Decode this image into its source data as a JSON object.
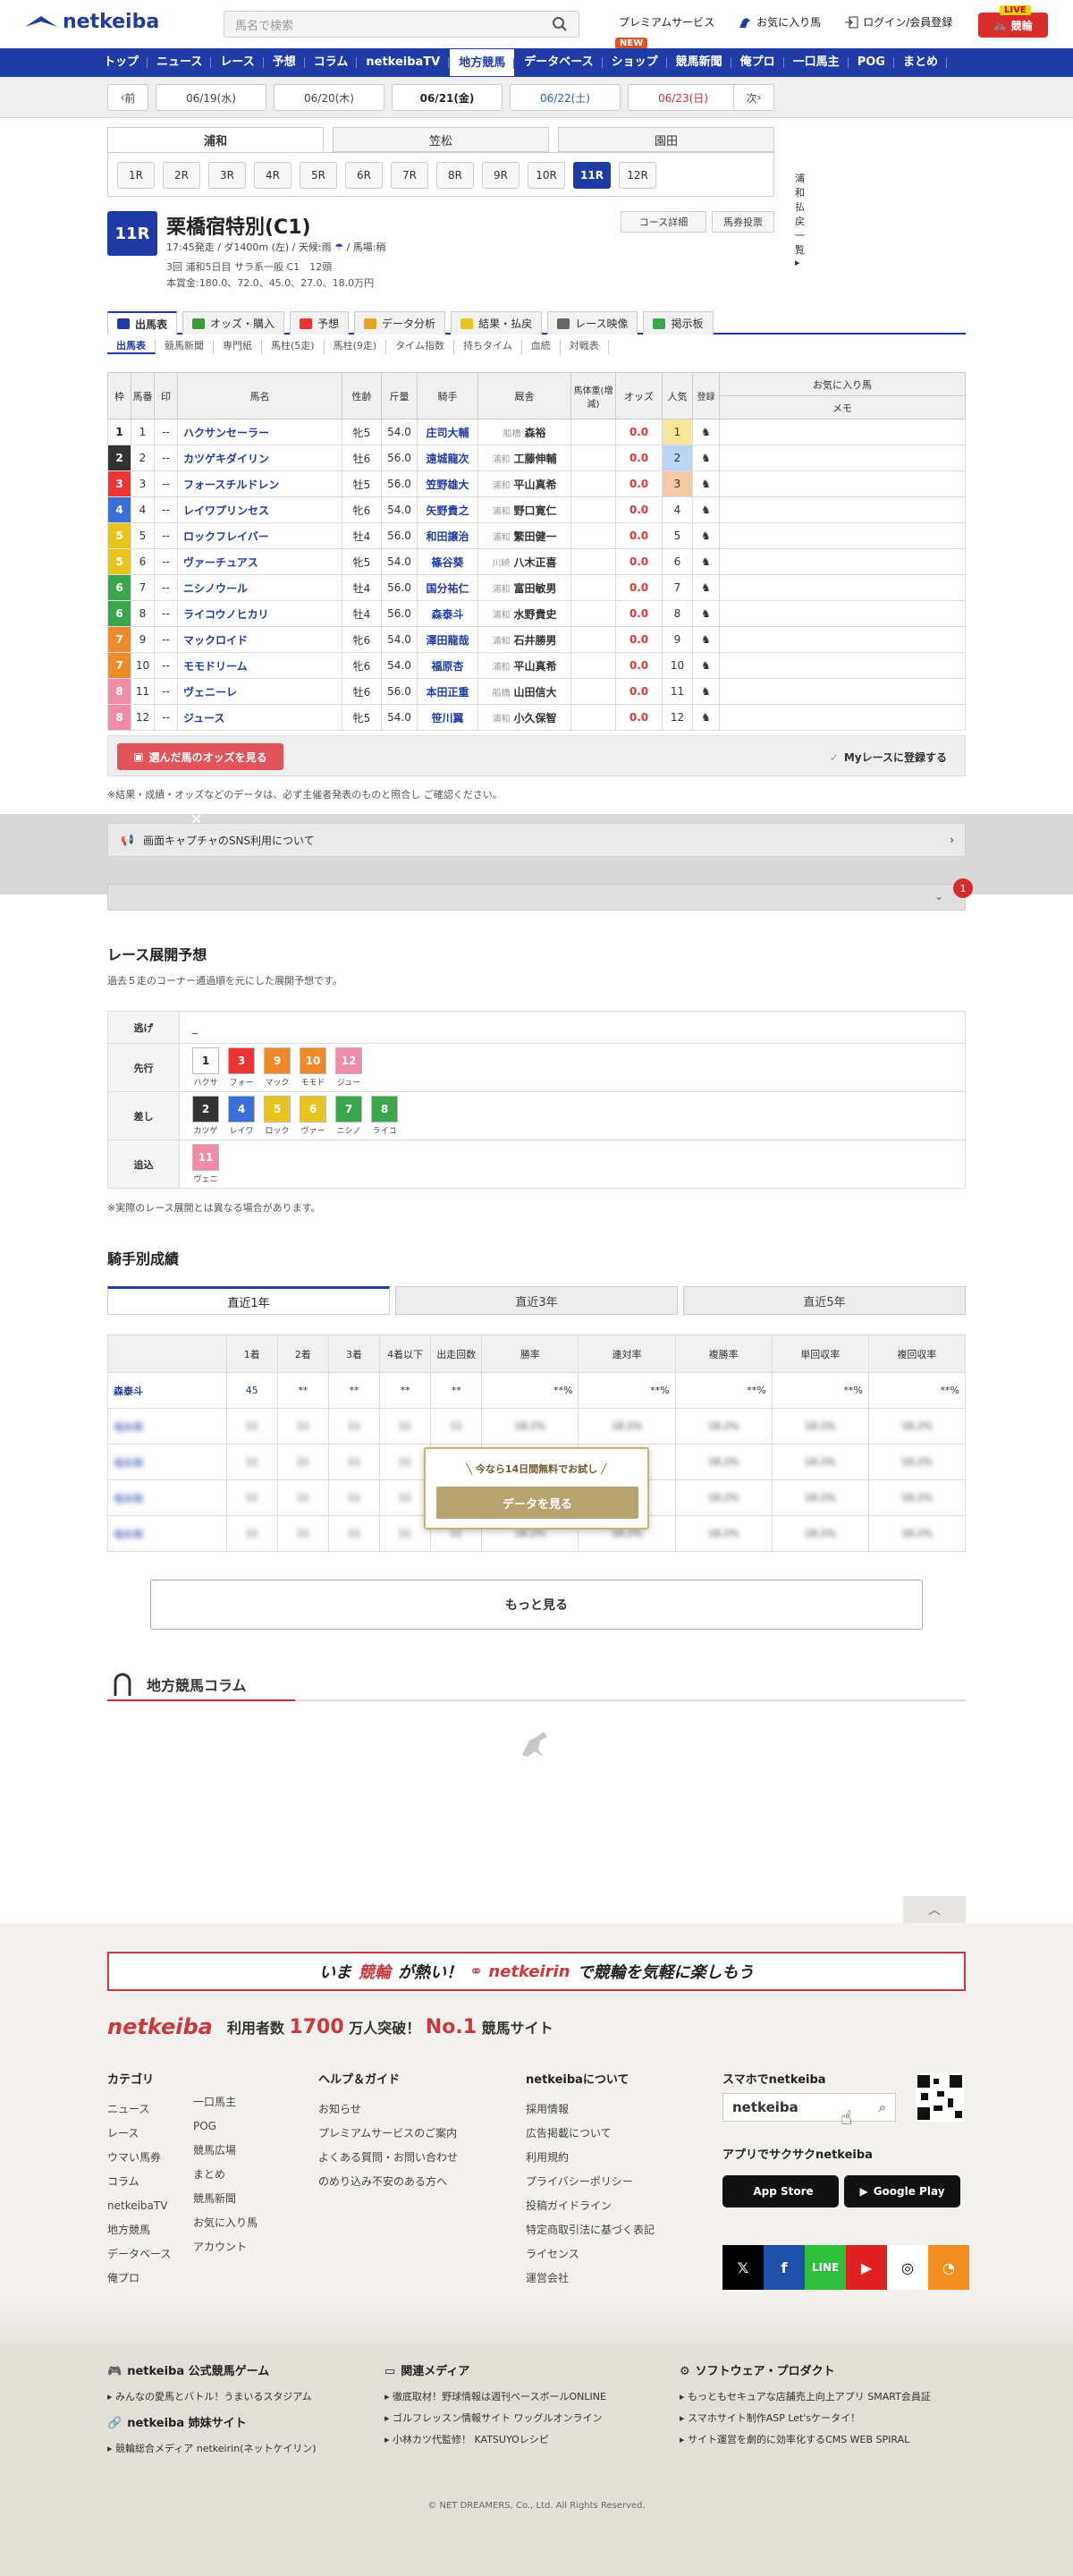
{
  "header": {
    "logo": "netkeiba",
    "search_placeholder": "馬名で検索",
    "links": [
      "プレミアムサービス",
      "お気に入り馬",
      "ログイン/会員登録"
    ],
    "new_badge": "NEW",
    "keirin_label": "競輪",
    "live_badge": "LIVE"
  },
  "nav": [
    "トップ",
    "ニュース",
    "レース",
    "予想",
    "コラム",
    "netkeibaTV",
    "地方競馬",
    "データベース",
    "ショップ",
    "競馬新聞",
    "俺プロ",
    "一口馬主",
    "POG",
    "まとめ"
  ],
  "nav_active": "地方競馬",
  "datebar": {
    "prev": "前",
    "next": "次",
    "dates": [
      "06/19(水)",
      "06/20(木)",
      "06/21(金)",
      "06/22(土)",
      "06/23(日)"
    ]
  },
  "venues": [
    "浦和",
    "笠松",
    "園田"
  ],
  "races": [
    "1R",
    "2R",
    "3R",
    "4R",
    "5R",
    "6R",
    "7R",
    "8R",
    "9R",
    "10R",
    "11R",
    "12R"
  ],
  "payout_link": "浦和 払戻一覧",
  "race": {
    "num": "11R",
    "name": "栗橋宿特別(C1)",
    "info1": "17:45発走 / ダ1400m (左) / 天候:雨",
    "info1b": "/ 馬場:稍",
    "info2": "3回 浦和5日目 サラ系一般 C1　12頭",
    "info3": "本賞金:180.0、72.0、45.0、27.0、18.0万円",
    "btn_course": "コース詳細",
    "btn_vote": "馬券投票"
  },
  "tabs": [
    "出馬表",
    "オッズ・購入",
    "予想",
    "データ分析",
    "結果・払戻",
    "レース映像",
    "掲示板"
  ],
  "subtabs": [
    "出馬表",
    "競馬新聞",
    "専門紙",
    "馬柱(5走)",
    "馬柱(9走)",
    "タイム指数",
    "持ちタイム",
    "血統",
    "対戦表"
  ],
  "table": {
    "headers": [
      "枠",
      "馬番",
      "印",
      "馬名",
      "性齢",
      "斤量",
      "騎手",
      "厩舎",
      "馬体重(増減)",
      "オッズ",
      "人気",
      "登録",
      "お気に入り馬",
      "メモ"
    ],
    "rows": [
      {
        "waku": "1",
        "num": "1",
        "mark": "--",
        "name": "ハクサンセーラー",
        "sex": "牝5",
        "kin": "54.0",
        "jockey": "庄司大輔",
        "loc": "船橋",
        "trainer": "森裕",
        "odds": "0.0",
        "pop": "1"
      },
      {
        "waku": "2",
        "num": "2",
        "mark": "--",
        "name": "カツゲキダイリン",
        "sex": "牡6",
        "kin": "56.0",
        "jockey": "遠城龍次",
        "loc": "浦和",
        "trainer": "工藤伸輔",
        "odds": "0.0",
        "pop": "2"
      },
      {
        "waku": "3",
        "num": "3",
        "mark": "--",
        "name": "フォースチルドレン",
        "sex": "牡5",
        "kin": "56.0",
        "jockey": "笠野雄大",
        "loc": "浦和",
        "trainer": "平山真希",
        "odds": "0.0",
        "pop": "3"
      },
      {
        "waku": "4",
        "num": "4",
        "mark": "--",
        "name": "レイワプリンセス",
        "sex": "牝6",
        "kin": "54.0",
        "jockey": "矢野貴之",
        "loc": "浦和",
        "trainer": "野口寛仁",
        "odds": "0.0",
        "pop": "4"
      },
      {
        "waku": "5",
        "num": "5",
        "mark": "--",
        "name": "ロックフレイバー",
        "sex": "牡4",
        "kin": "56.0",
        "jockey": "和田譲治",
        "loc": "浦和",
        "trainer": "繁田健一",
        "odds": "0.0",
        "pop": "5"
      },
      {
        "waku": "5",
        "num": "6",
        "mark": "--",
        "name": "ヴァーチュアス",
        "sex": "牝5",
        "kin": "54.0",
        "jockey": "篠谷葵",
        "loc": "川崎",
        "trainer": "八木正喜",
        "odds": "0.0",
        "pop": "6"
      },
      {
        "waku": "6",
        "num": "7",
        "mark": "--",
        "name": "ニシノウール",
        "sex": "牡4",
        "kin": "56.0",
        "jockey": "国分祐仁",
        "loc": "浦和",
        "trainer": "富田敏男",
        "odds": "0.0",
        "pop": "7"
      },
      {
        "waku": "6",
        "num": "8",
        "mark": "--",
        "name": "ライコウノヒカリ",
        "sex": "牡4",
        "kin": "56.0",
        "jockey": "森泰斗",
        "loc": "浦和",
        "trainer": "水野貴史",
        "odds": "0.0",
        "pop": "8"
      },
      {
        "waku": "7",
        "num": "9",
        "mark": "--",
        "name": "マックロイド",
        "sex": "牝6",
        "kin": "54.0",
        "jockey": "澤田龍哉",
        "loc": "浦和",
        "trainer": "石井勝男",
        "odds": "0.0",
        "pop": "9"
      },
      {
        "waku": "7",
        "num": "10",
        "mark": "--",
        "name": "モモドリーム",
        "sex": "牝6",
        "kin": "54.0",
        "jockey": "福原杏",
        "loc": "浦和",
        "trainer": "平山真希",
        "odds": "0.0",
        "pop": "10"
      },
      {
        "waku": "8",
        "num": "11",
        "mark": "--",
        "name": "ヴェニーレ",
        "sex": "牡6",
        "kin": "56.0",
        "jockey": "本田正重",
        "loc": "船橋",
        "trainer": "山田信大",
        "odds": "0.0",
        "pop": "11"
      },
      {
        "waku": "8",
        "num": "12",
        "mark": "--",
        "name": "ジュース",
        "sex": "牝5",
        "kin": "54.0",
        "jockey": "笹川翼",
        "loc": "浦和",
        "trainer": "小久保智",
        "odds": "0.0",
        "pop": "12"
      }
    ],
    "odds_button": "選んだ馬のオッズを見る",
    "my_race": "Myレースに登録する"
  },
  "note": "※結果・成績・オッズなどのデータは、必ず主催者発表のものと照合し ご確認ください。",
  "sns_notice": "画面キャプチャのSNS利用について",
  "notif_count": "1",
  "tenkai": {
    "title": "レース展開予想",
    "sub": "過去５走のコーナー通過順を元にした展開予想です。",
    "rows": [
      {
        "label": "逃げ",
        "chips": [],
        "text": "_"
      },
      {
        "label": "先行",
        "chips": [
          {
            "n": "1",
            "w": "1",
            "nm": "ハクサ"
          },
          {
            "n": "3",
            "w": "3",
            "nm": "フォー"
          },
          {
            "n": "9",
            "w": "7",
            "nm": "マック"
          },
          {
            "n": "10",
            "w": "7",
            "nm": "モモド"
          },
          {
            "n": "12",
            "w": "8",
            "nm": "ジュー"
          }
        ]
      },
      {
        "label": "差し",
        "chips": [
          {
            "n": "2",
            "w": "2",
            "nm": "カツゲ"
          },
          {
            "n": "4",
            "w": "4",
            "nm": "レイワ"
          },
          {
            "n": "5",
            "w": "5",
            "nm": "ロック"
          },
          {
            "n": "6",
            "w": "5",
            "nm": "ヴァー"
          },
          {
            "n": "7",
            "w": "6",
            "nm": "ニシノ"
          },
          {
            "n": "8",
            "w": "6",
            "nm": "ライコ"
          }
        ]
      },
      {
        "label": "追込",
        "chips": [
          {
            "n": "11",
            "w": "8",
            "nm": "ヴェニ"
          }
        ]
      }
    ],
    "note": "※実際のレース展開とは異なる場合があります。"
  },
  "jockey": {
    "title": "騎手別成績",
    "tabs": [
      "直近1年",
      "直近3年",
      "直近5年"
    ],
    "headers": [
      "",
      "1着",
      "2着",
      "3着",
      "4着以下",
      "出走回数",
      "勝率",
      "連対率",
      "複勝率",
      "単回収率",
      "複回収率"
    ],
    "first_row": [
      "森泰斗",
      "45",
      "**",
      "**",
      "**",
      "**",
      "**%",
      "**%",
      "**%",
      "**%",
      "**%"
    ],
    "blur_name": "福永騎",
    "blur_cell": "11",
    "blur_pct": "18.2%",
    "trial_text": "今なら14日間無料でお試し",
    "trial_btn": "データを見る",
    "more": "もっと見る"
  },
  "column": {
    "title": "地方競馬コラム"
  },
  "footer": {
    "banner_left": "いま",
    "banner_hl": "競輪",
    "banner_mid": "が熱い！",
    "banner_brand": "netkeirin",
    "banner_right": "で競輪を気軽に楽しもう",
    "brand": "netkeiba",
    "users_pre": "利用者数",
    "users_num": "1700",
    "users_mid": "万人突破！",
    "no1": "No.1",
    "users_post": "競馬サイト",
    "cat_title": "カテゴリ",
    "cat_col1": [
      "ニュース",
      "レース",
      "ウマい馬券",
      "コラム",
      "netkeibaTV",
      "地方競馬",
      "データベース",
      "俺プロ"
    ],
    "cat_col2": [
      "一口馬主",
      "POG",
      "競馬広場",
      "まとめ",
      "競馬新聞",
      "お気に入り馬",
      "アカウント"
    ],
    "help_title": "ヘルプ＆ガイド",
    "help": [
      "お知らせ",
      "プレミアムサービスのご案内",
      "よくある質問・お問い合わせ",
      "のめり込み不安のある方へ"
    ],
    "about_title": "netkeibaについて",
    "about": [
      "採用情報",
      "広告掲載について",
      "利用規約",
      "プライバシーポリシー",
      "投稿ガイドライン",
      "特定商取引法に基づく表記",
      "ライセンス",
      "運営会社"
    ],
    "phone_title": "スマホでnetkeiba",
    "phone_search": "netkeiba",
    "app_title": "アプリでサクサクnetkeiba",
    "appstore": "App Store",
    "googleplay": "Google Play",
    "game_title": "netkeiba 公式競馬ゲーム",
    "game_item": "みんなの愛馬とバトル！うまいるスタジアム",
    "sister_title": "netkeiba 姉妹サイト",
    "sister_item": "競輪総合メディア netkeirin(ネットケイリン)",
    "media_title": "関連メディア",
    "media_items": [
      "徹底取材！野球情報は週刊ベースボールONLINE",
      "ゴルフレッスン情報サイト ワッグルオンライン",
      "小林カツ代監修！ KATSUYOレシピ"
    ],
    "soft_title": "ソフトウェア・プロダクト",
    "soft_items": [
      "もっともセキュアな店舗売上向上アプリ SMART会員証",
      "スマホサイト制作ASP Let'sケータイ！",
      "サイト運営を劇的に効率化するCMS WEB SPIRAL"
    ],
    "copyright": "© NET DREAMERS, Co., Ltd. All Rights Reserved."
  }
}
